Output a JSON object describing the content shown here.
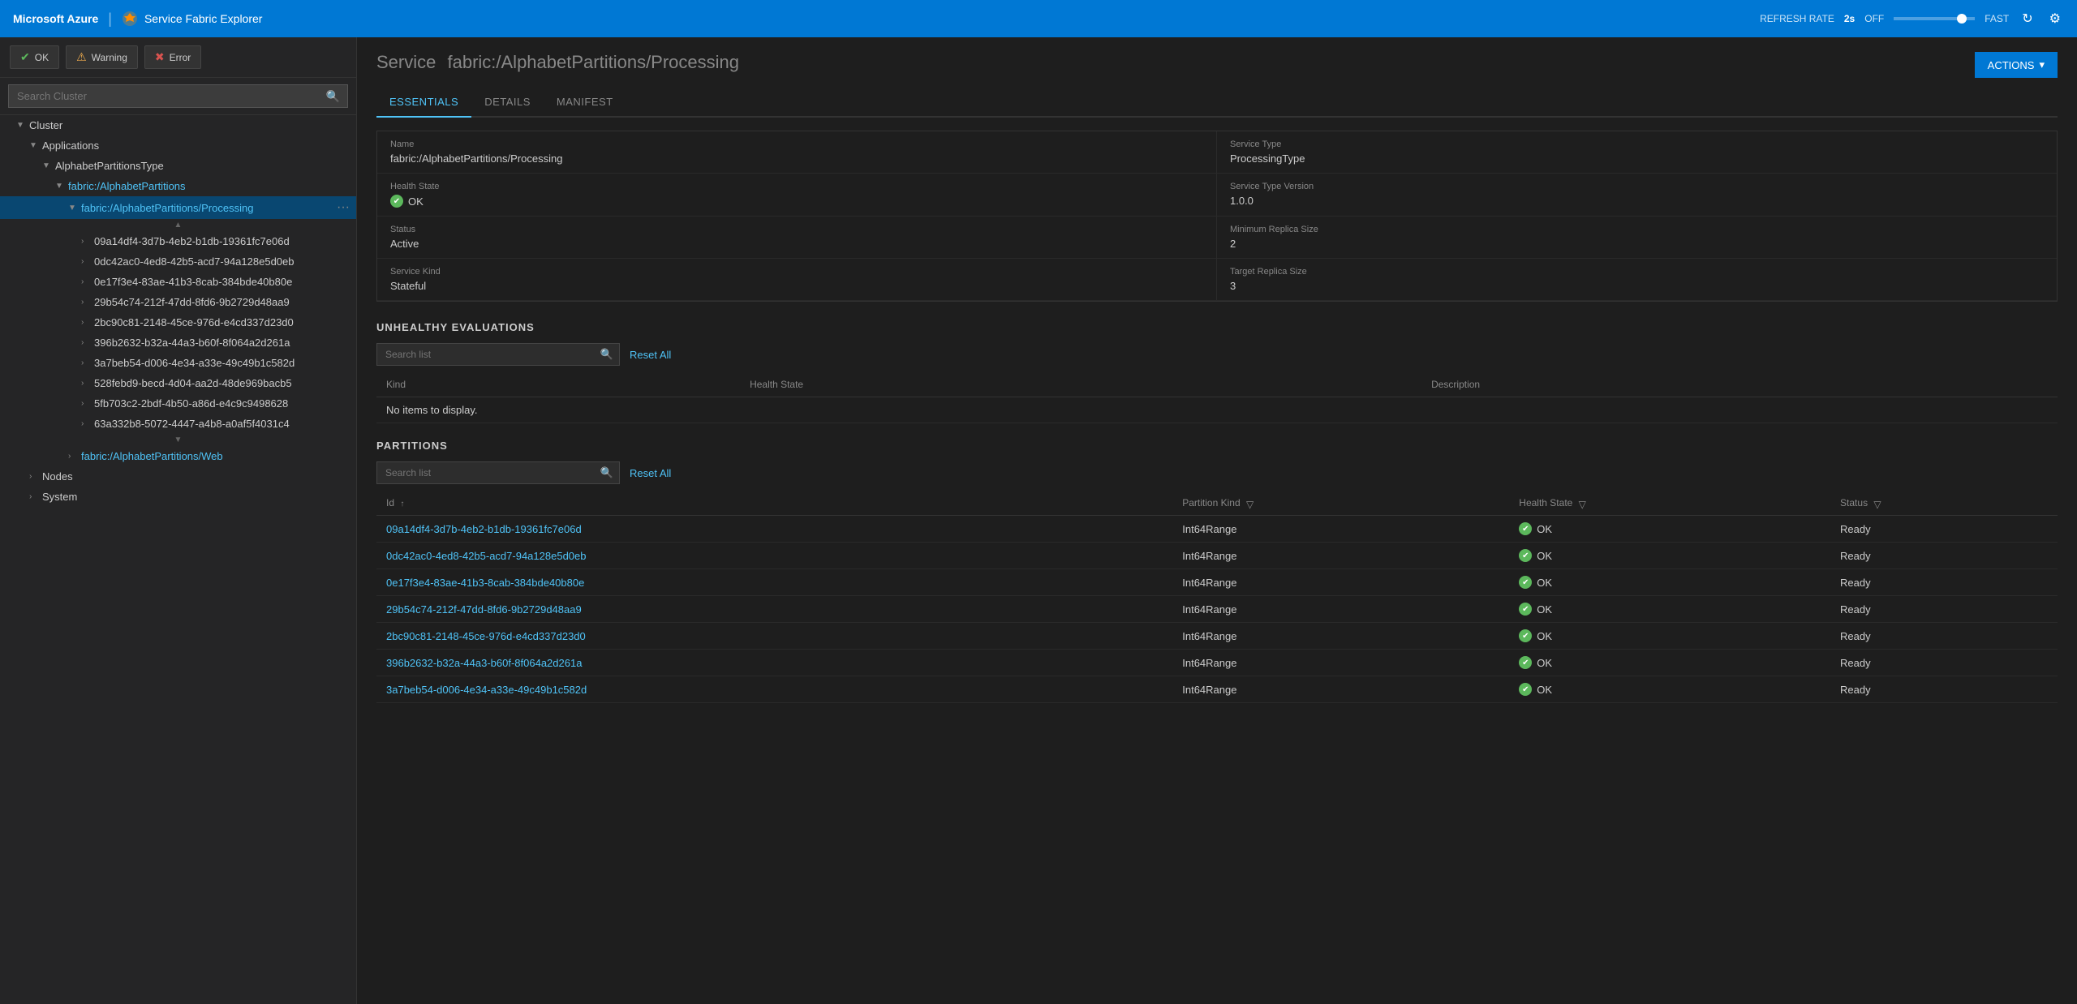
{
  "topbar": {
    "brand": "Microsoft Azure",
    "app_name": "Service Fabric Explorer",
    "refresh_label": "REFRESH RATE",
    "refresh_rate": "2s",
    "off_label": "OFF",
    "fast_label": "FAST"
  },
  "status_bar": {
    "ok_label": "OK",
    "warning_label": "Warning",
    "error_label": "Error"
  },
  "search_cluster": {
    "placeholder": "Search Cluster"
  },
  "tree": {
    "cluster_label": "Cluster",
    "applications_label": "Applications",
    "alphabet_partitions_type": "AlphabetPartitionsType",
    "alphabet_partitions": "fabric:/AlphabetPartitions",
    "processing": "fabric:/AlphabetPartitions/Processing",
    "web": "fabric:/AlphabetPartitions/Web",
    "nodes": "Nodes",
    "system": "System",
    "partitions": [
      "09a14df4-3d7b-4eb2-b1db-19361fc7e06d",
      "0dc42ac0-4ed8-42b5-acd7-94a128e5d0eb",
      "0e17f3e4-83ae-41b3-8cab-384bde40b80e",
      "29b54c74-212f-47dd-8fd6-9b2729d48aa9",
      "2bc90c81-2148-45ce-976d-e4cd337d23d0",
      "396b2632-b32a-44a3-b60f-8f064a2d261a",
      "3a7beb54-d006-4e34-a33e-49c49b1c582d",
      "528febd9-becd-4d04-aa2d-48de969bacb5",
      "5fb703c2-2bdf-4b50-a86d-e4c9c9498628",
      "63a332b8-5072-4447-a4b8-a0af5f4031c4"
    ]
  },
  "content": {
    "service_prefix": "Service",
    "service_name": "fabric:/AlphabetPartitions/Processing",
    "actions_label": "ACTIONS",
    "tabs": [
      "ESSENTIALS",
      "DETAILS",
      "MANIFEST"
    ],
    "active_tab": "ESSENTIALS"
  },
  "essentials": {
    "name_label": "Name",
    "name_value": "fabric:/AlphabetPartitions/Processing",
    "health_state_label": "Health State",
    "health_state_value": "OK",
    "status_label": "Status",
    "status_value": "Active",
    "service_kind_label": "Service Kind",
    "service_kind_value": "Stateful",
    "service_type_label": "Service Type",
    "service_type_value": "ProcessingType",
    "service_type_version_label": "Service Type Version",
    "service_type_version_value": "1.0.0",
    "min_replica_label": "Minimum Replica Size",
    "min_replica_value": "2",
    "target_replica_label": "Target Replica Size",
    "target_replica_value": "3"
  },
  "unhealthy": {
    "section_title": "UNHEALTHY EVALUATIONS",
    "search_placeholder": "Search list",
    "reset_label": "Reset All",
    "col_kind": "Kind",
    "col_health": "Health State",
    "col_desc": "Description",
    "no_items": "No items to display."
  },
  "partitions": {
    "section_title": "PARTITIONS",
    "search_placeholder": "Search list",
    "reset_label": "Reset All",
    "col_id": "Id",
    "col_partition_kind": "Partition Kind",
    "col_health_state": "Health State",
    "col_status": "Status",
    "rows": [
      {
        "id": "09a14df4-3d7b-4eb2-b1db-19361fc7e06d",
        "kind": "Int64Range",
        "health": "OK",
        "status": "Ready"
      },
      {
        "id": "0dc42ac0-4ed8-42b5-acd7-94a128e5d0eb",
        "kind": "Int64Range",
        "health": "OK",
        "status": "Ready"
      },
      {
        "id": "0e17f3e4-83ae-41b3-8cab-384bde40b80e",
        "kind": "Int64Range",
        "health": "OK",
        "status": "Ready"
      },
      {
        "id": "29b54c74-212f-47dd-8fd6-9b2729d48aa9",
        "kind": "Int64Range",
        "health": "OK",
        "status": "Ready"
      },
      {
        "id": "2bc90c81-2148-45ce-976d-e4cd337d23d0",
        "kind": "Int64Range",
        "health": "OK",
        "status": "Ready"
      },
      {
        "id": "396b2632-b32a-44a3-b60f-8f064a2d261a",
        "kind": "Int64Range",
        "health": "OK",
        "status": "Ready"
      },
      {
        "id": "3a7beb54-d006-4e34-a33e-49c49b1c582d",
        "kind": "Int64Range",
        "health": "OK",
        "status": "Ready"
      }
    ]
  }
}
